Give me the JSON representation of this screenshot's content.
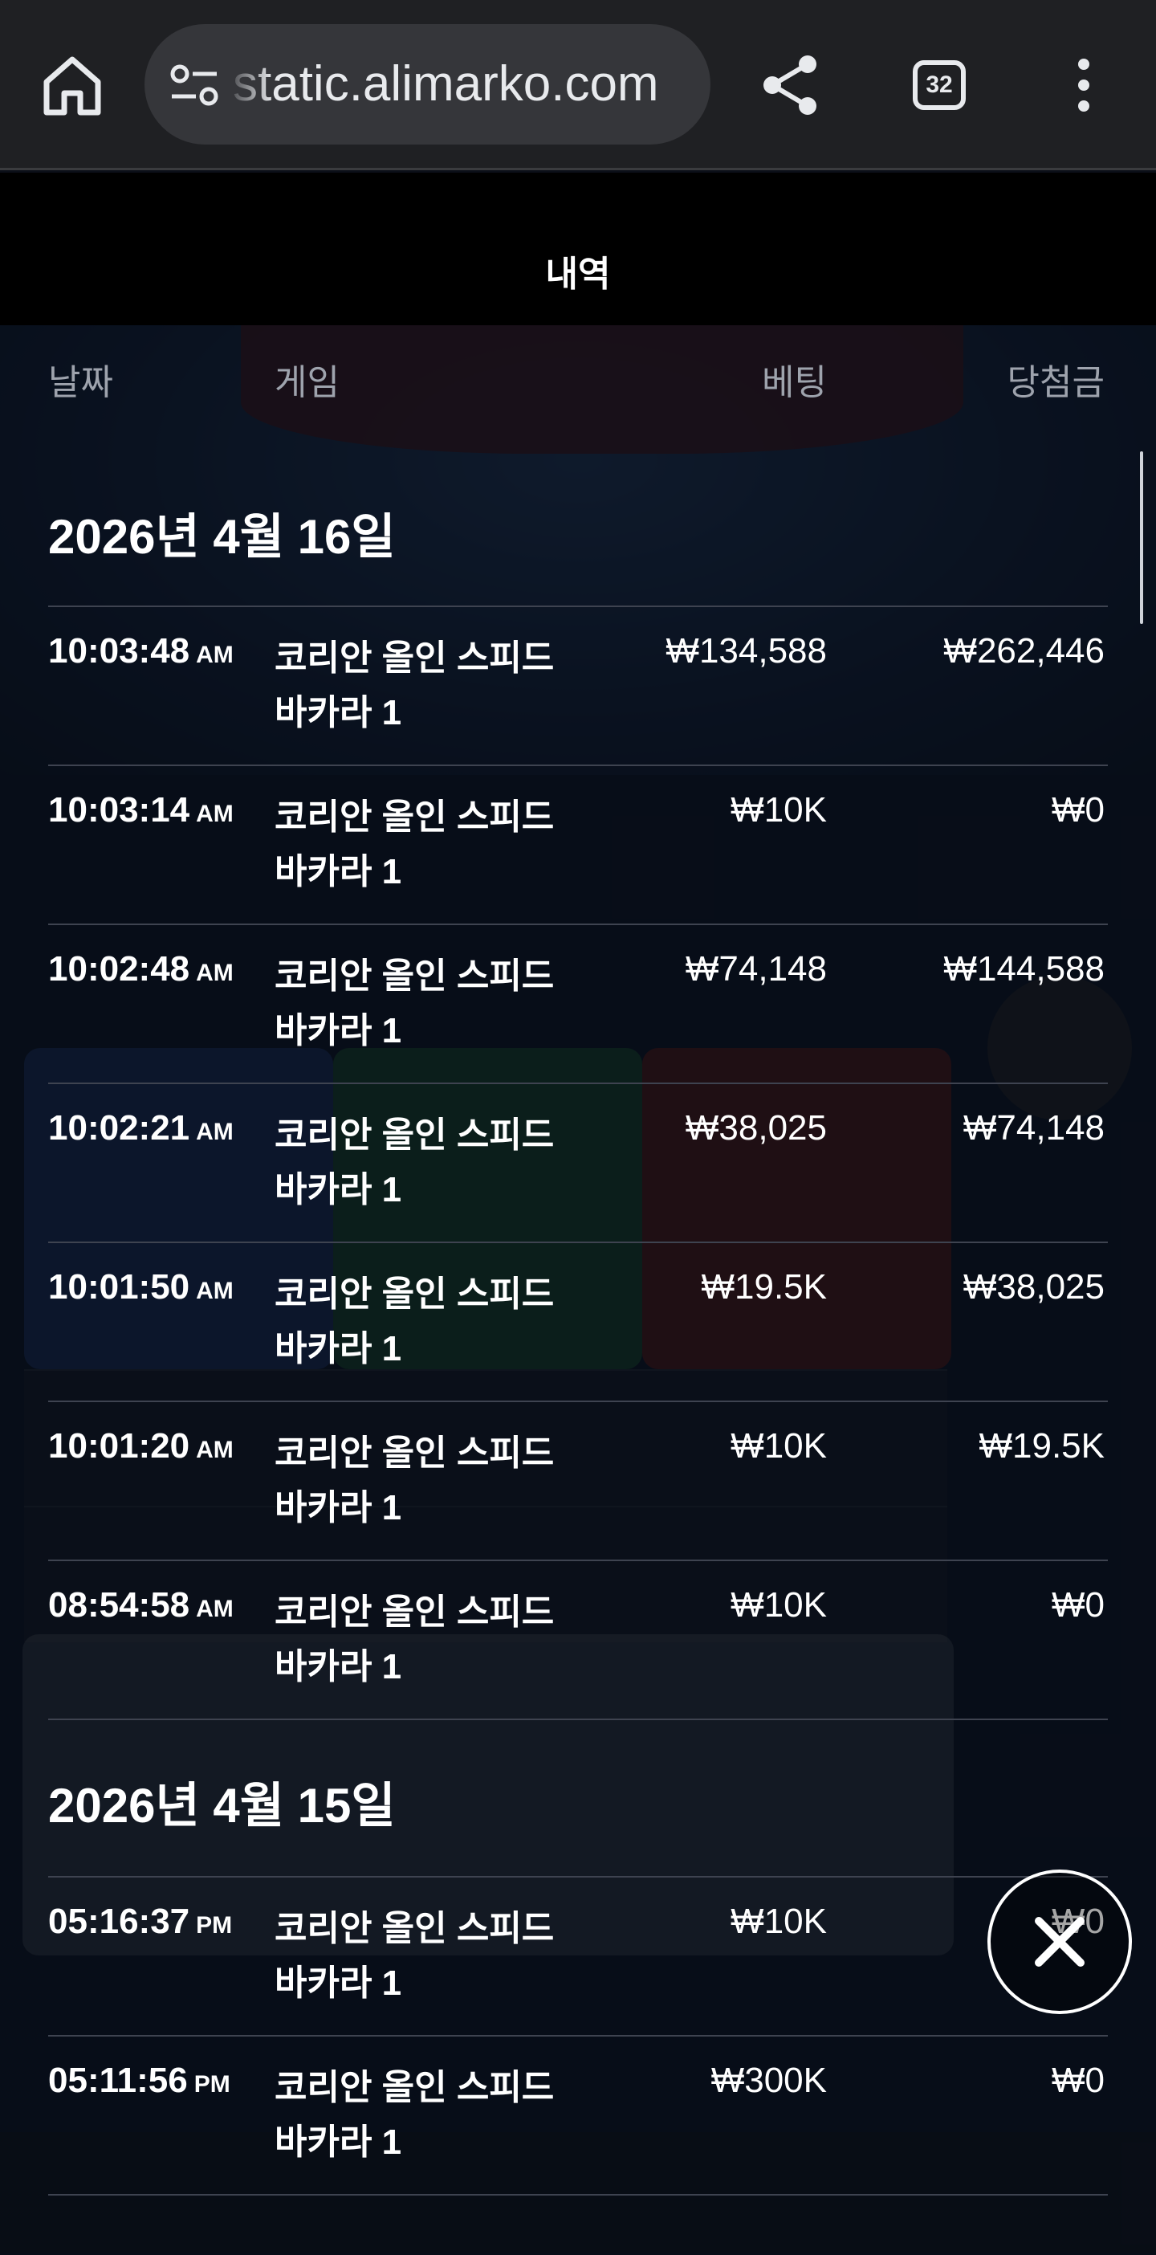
{
  "browser": {
    "url": "static.alimarko.com",
    "tab_count": "32"
  },
  "panel": {
    "title": "내역",
    "columns": {
      "date": "날짜",
      "game": "게임",
      "bet": "베팅",
      "win": "당첨금"
    }
  },
  "groups": [
    {
      "date": "2026년 4월 16일",
      "rows": [
        {
          "time": "10:03:48",
          "ampm": "AM",
          "game": "코리안 올인 스피드 바카라 1",
          "bet": "₩134,588",
          "win": "₩262,446"
        },
        {
          "time": "10:03:14",
          "ampm": "AM",
          "game": "코리안 올인 스피드 바카라 1",
          "bet": "₩10K",
          "win": "₩0"
        },
        {
          "time": "10:02:48",
          "ampm": "AM",
          "game": "코리안 올인 스피드 바카라 1",
          "bet": "₩74,148",
          "win": "₩144,588"
        },
        {
          "time": "10:02:21",
          "ampm": "AM",
          "game": "코리안 올인 스피드 바카라 1",
          "bet": "₩38,025",
          "win": "₩74,148"
        },
        {
          "time": "10:01:50",
          "ampm": "AM",
          "game": "코리안 올인 스피드 바카라 1",
          "bet": "₩19.5K",
          "win": "₩38,025"
        },
        {
          "time": "10:01:20",
          "ampm": "AM",
          "game": "코리안 올인 스피드 바카라 1",
          "bet": "₩10K",
          "win": "₩19.5K"
        },
        {
          "time": "08:54:58",
          "ampm": "AM",
          "game": "코리안 올인 스피드 바카라 1",
          "bet": "₩10K",
          "win": "₩0"
        }
      ]
    },
    {
      "date": "2026년 4월 15일",
      "rows": [
        {
          "time": "05:16:37",
          "ampm": "PM",
          "game": "코리안 올인 스피드 바카라 1",
          "bet": "₩10K",
          "win": "₩0"
        },
        {
          "time": "05:11:56",
          "ampm": "PM",
          "game": "코리안 올인 스피드 바카라 1",
          "bet": "₩300K",
          "win": "₩0"
        }
      ]
    }
  ],
  "icons": {
    "home": "home-icon",
    "site_settings": "tune-icon",
    "share": "share-icon",
    "menu": "more-vert-icon",
    "close": "close-icon"
  }
}
